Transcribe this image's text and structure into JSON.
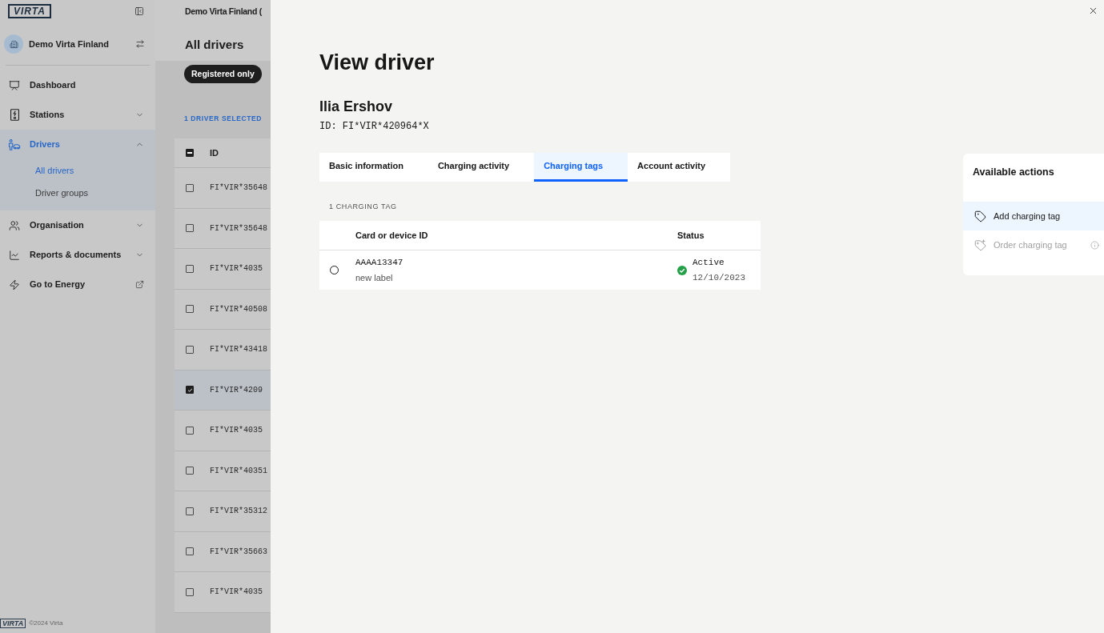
{
  "sidebar": {
    "logo": "VIRTA",
    "organisation": "Demo Virta Finland",
    "nav": [
      {
        "label": "Dashboard",
        "kind": "link",
        "selected": false
      },
      {
        "label": "Stations",
        "kind": "group",
        "selected": false,
        "expanded": false
      },
      {
        "label": "Drivers",
        "kind": "group",
        "selected": true,
        "expanded": true,
        "children": [
          {
            "label": "All drivers",
            "selected": true
          },
          {
            "label": "Driver groups",
            "selected": false
          }
        ]
      },
      {
        "label": "Organisation",
        "kind": "group",
        "selected": false,
        "expanded": false
      },
      {
        "label": "Reports & documents",
        "kind": "group",
        "selected": false,
        "expanded": false
      },
      {
        "label": "Go to Energy",
        "kind": "external",
        "selected": false
      }
    ],
    "footer": {
      "logo": "VIRTA",
      "copyright": "©2024 Virta"
    }
  },
  "background_page": {
    "breadcrumb": "Demo Virta Finland (",
    "title": "All drivers",
    "filter_chip": "Registered only",
    "selection_count": "1 DRIVER SELECTED",
    "table": {
      "columns": [
        "ID"
      ],
      "select_all": {
        "indeterminate": true
      },
      "rows": [
        {
          "id": "FI*VIR*35648",
          "selected": false
        },
        {
          "id": "FI*VIR*35648",
          "selected": false
        },
        {
          "id": "FI*VIR*4035",
          "selected": false
        },
        {
          "id": "FI*VIR*40508",
          "selected": false
        },
        {
          "id": "FI*VIR*43418",
          "selected": false
        },
        {
          "id": "FI*VIR*4209",
          "selected": true
        },
        {
          "id": "FI*VIR*4035",
          "selected": false
        },
        {
          "id": "FI*VIR*40351",
          "selected": false
        },
        {
          "id": "FI*VIR*35312",
          "selected": false
        },
        {
          "id": "FI*VIR*35663",
          "selected": false
        },
        {
          "id": "FI*VIR*4035",
          "selected": false
        }
      ]
    }
  },
  "drawer": {
    "title": "View driver",
    "name": "Ilia Ershov",
    "driver_id": "ID: FI*VIR*420964*X",
    "tabs": [
      {
        "label": "Basic information",
        "selected": false
      },
      {
        "label": "Charging activity",
        "selected": false
      },
      {
        "label": "Charging tags",
        "selected": true
      },
      {
        "label": "Account activity",
        "selected": false
      }
    ],
    "tag_count": "1 CHARGING TAG",
    "tags_table": {
      "columns": [
        "Card or device ID",
        "Status"
      ],
      "rows": [
        {
          "card_id": "AAAA13347",
          "label": "new label",
          "status": "Active",
          "status_date": "12/10/2023",
          "selected": false
        }
      ]
    }
  },
  "actions": {
    "title": "Available actions",
    "items": [
      {
        "label": "Add charging tag",
        "highlighted": true,
        "disabled": false,
        "info": false
      },
      {
        "label": "Order charging tag",
        "highlighted": false,
        "disabled": true,
        "info": true
      }
    ]
  }
}
